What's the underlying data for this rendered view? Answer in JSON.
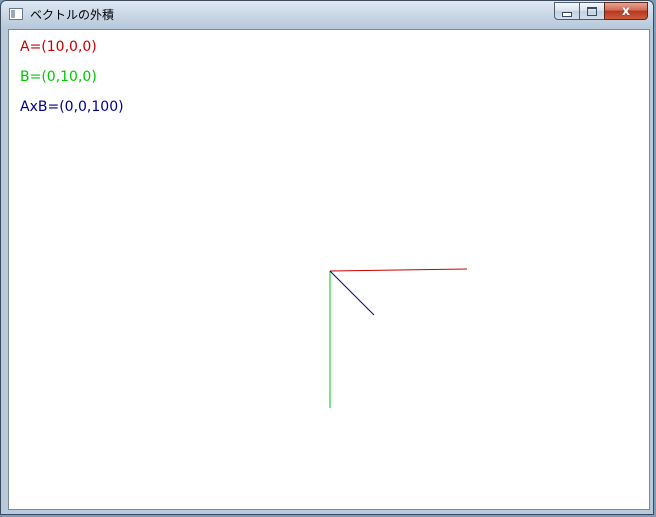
{
  "window": {
    "title": "ベクトルの外積",
    "controls": {
      "minimize": "minimize",
      "maximize": "maximize",
      "close": "x"
    }
  },
  "vectors": {
    "a": {
      "label": "A=(10,0,0)",
      "color": "#c80000",
      "value": [
        10,
        0,
        0
      ]
    },
    "b": {
      "label": "B=(0,10,0)",
      "color": "#00c800",
      "value": [
        0,
        10,
        0
      ]
    },
    "axb": {
      "label": "AxB=(0,0,100)",
      "color": "#000096",
      "value": [
        0,
        0,
        100
      ]
    }
  }
}
